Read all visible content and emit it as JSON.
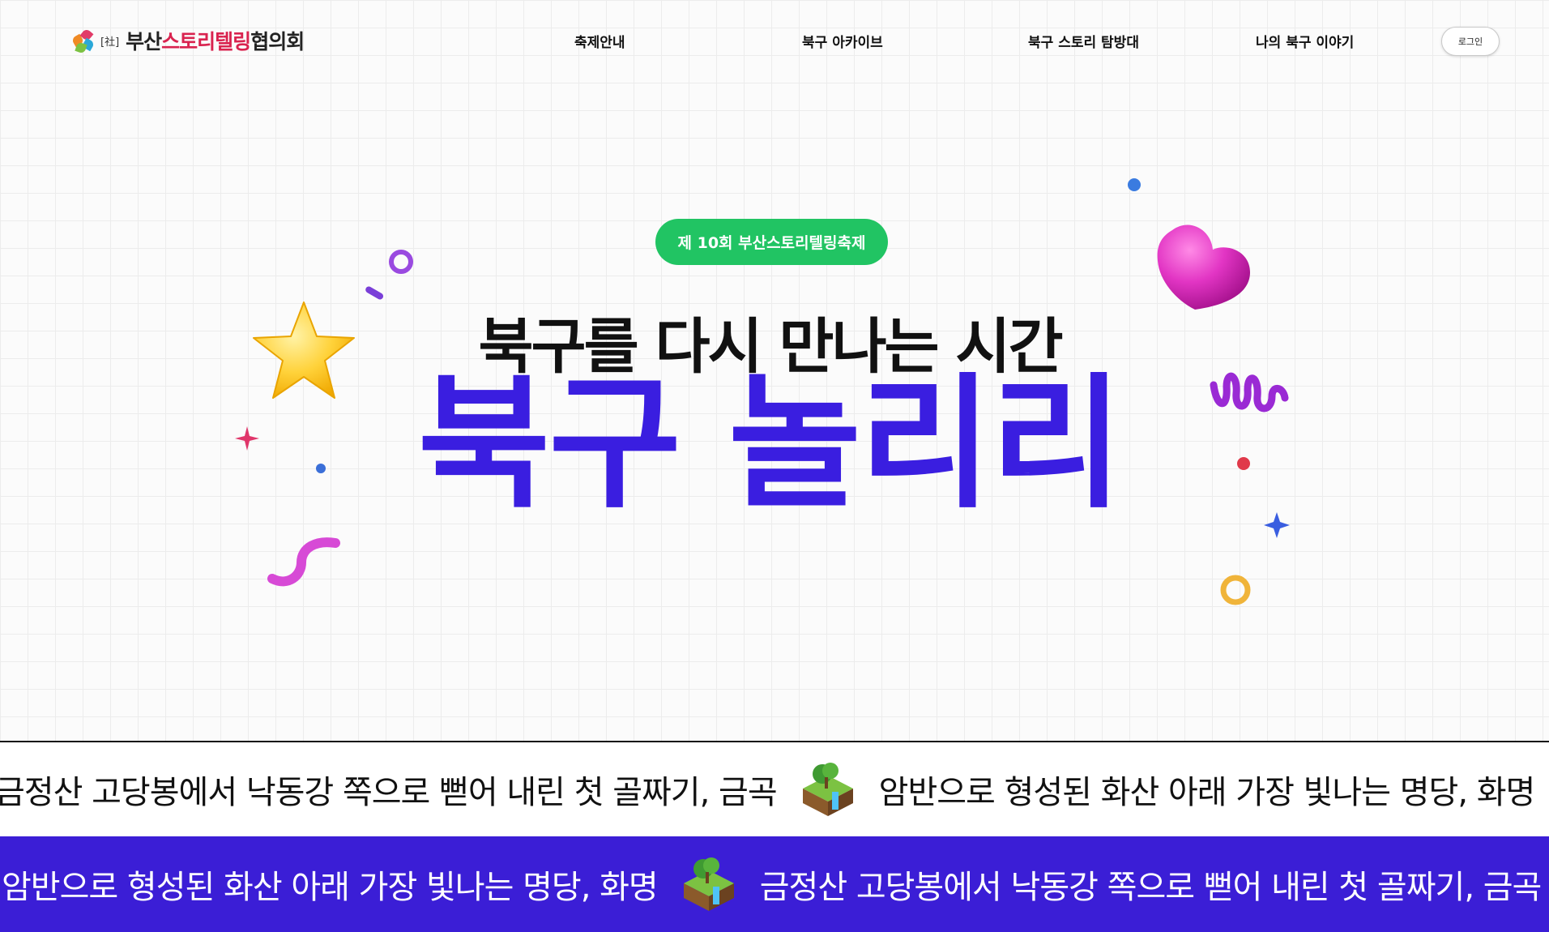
{
  "header": {
    "logo": {
      "prefix": "[社]",
      "name_part1": "부산",
      "name_part2": "스토리텔링",
      "name_part3": "협의회"
    },
    "nav": [
      "축제안내",
      "북구 아카이브",
      "북구 스토리 탐방대",
      "나의 북구 이야기"
    ],
    "login_label": "로그인"
  },
  "hero": {
    "badge": "제 10회 부산스토리텔링축제",
    "subtitle": "북구를 다시 만나는 시간",
    "title": "북구 놀리리"
  },
  "tickers": {
    "row1": [
      "금정산 고당봉에서 낙동강 쪽으로 뻗어 내린 첫 골짜기, 금곡",
      "암반으로 형성된 화산 아래 가장 빛나는 명당, 화명"
    ],
    "row2": [
      "암반으로 형성된 화산 아래 가장 빛나는 명당, 화명",
      "금정산 고당봉에서 낙동강 쪽으로 뻗어 내린 첫 골짜기, 금곡"
    ]
  },
  "colors": {
    "accent": "#3a1ee0",
    "badge": "#21c463",
    "logo_red": "#d9234f",
    "ticker_bg": "#3b1ed6"
  },
  "icons": [
    "logo-pinwheel-icon",
    "star-icon",
    "heart-icon",
    "island-icon",
    "sparkle-icon",
    "ring-icon",
    "squiggle-icon"
  ]
}
